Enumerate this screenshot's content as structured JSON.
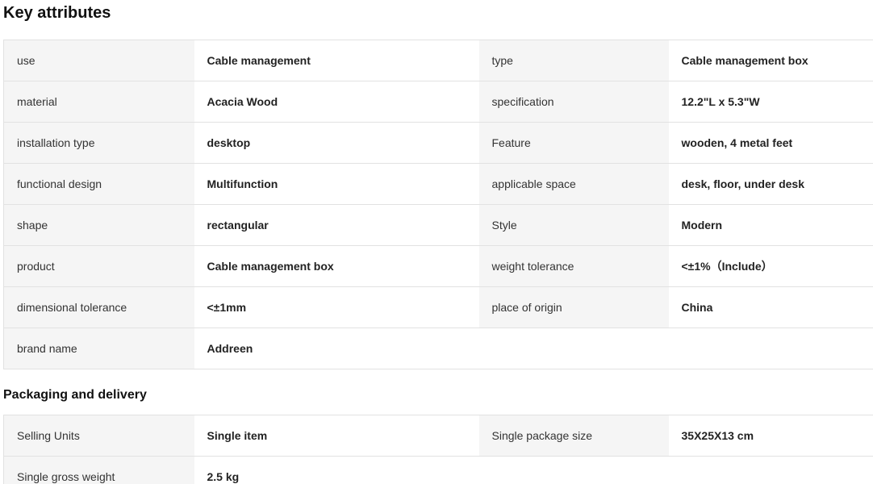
{
  "key_attributes": {
    "title": "Key attributes",
    "rows": [
      {
        "l1": "use",
        "v1": "Cable management",
        "l2": "type",
        "v2": "Cable management box"
      },
      {
        "l1": "material",
        "v1": "Acacia Wood",
        "l2": "specification",
        "v2": "12.2\"L x 5.3\"W"
      },
      {
        "l1": "installation type",
        "v1": "desktop",
        "l2": "Feature",
        "v2": "wooden, 4 metal feet"
      },
      {
        "l1": "functional design",
        "v1": "Multifunction",
        "l2": "applicable space",
        "v2": "desk, floor, under desk"
      },
      {
        "l1": "shape",
        "v1": "rectangular",
        "l2": "Style",
        "v2": "Modern"
      },
      {
        "l1": "product",
        "v1": "Cable management box",
        "l2": "weight tolerance",
        "v2": "<±1%（Include）"
      },
      {
        "l1": "dimensional tolerance",
        "v1": "<±1mm",
        "l2": "place of origin",
        "v2": "China"
      },
      {
        "l1": "brand name",
        "v1": "Addreen",
        "l2": "",
        "v2": ""
      }
    ]
  },
  "packaging": {
    "title": "Packaging and delivery",
    "rows": [
      {
        "l1": "Selling Units",
        "v1": "Single item",
        "l2": "Single package size",
        "v2": "35X25X13 cm"
      },
      {
        "l1": "Single gross weight",
        "v1": "2.5 kg",
        "l2": "",
        "v2": ""
      }
    ]
  }
}
